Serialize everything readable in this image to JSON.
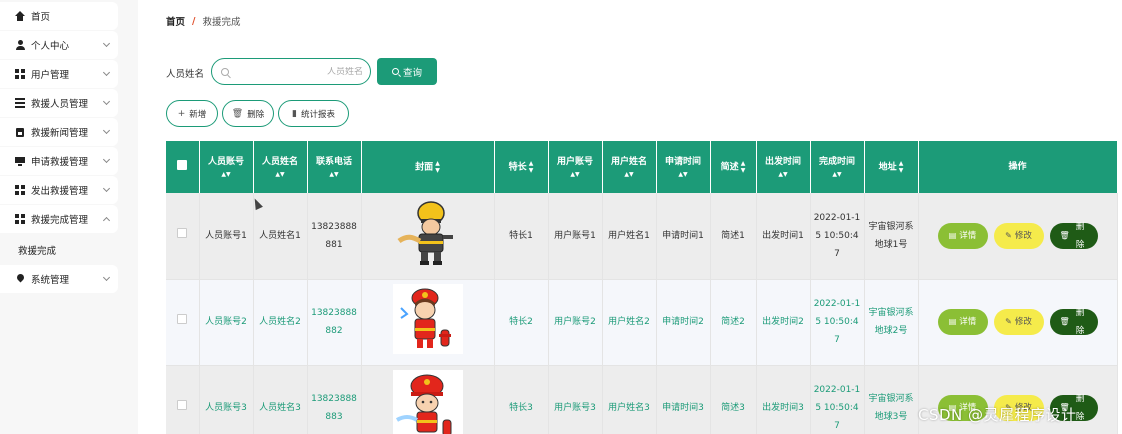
{
  "sidebar": {
    "items": [
      {
        "label": "首页",
        "icon": "home-icon"
      },
      {
        "label": "个人中心",
        "icon": "user-icon"
      },
      {
        "label": "用户管理",
        "icon": "grid-icon"
      },
      {
        "label": "救援人员管理",
        "icon": "list-icon"
      },
      {
        "label": "救援新闻管理",
        "icon": "calendar-icon"
      },
      {
        "label": "申请救援管理",
        "icon": "monitor-icon"
      },
      {
        "label": "发出救援管理",
        "icon": "grid-icon"
      },
      {
        "label": "救援完成管理",
        "icon": "grid-icon"
      },
      {
        "label": "系统管理",
        "icon": "pin-icon"
      }
    ],
    "submenu": {
      "label": "救援完成"
    }
  },
  "breadcrumb": {
    "home": "首页",
    "separator": "/",
    "current": "救援完成"
  },
  "search": {
    "label": "人员姓名",
    "placeholder": "人员姓名",
    "button": "查询"
  },
  "toolbar": {
    "add": "新增",
    "delete": "删除",
    "report": "统计报表"
  },
  "table": {
    "headers": {
      "account": "人员账号",
      "name": "人员姓名",
      "phone": "联系电话",
      "cover": "封面",
      "specialty": "特长",
      "user_account": "用户账号",
      "user_name": "用户姓名",
      "apply_time": "申请时间",
      "brief": "简述",
      "depart_time": "出发时间",
      "finish_time": "完成时间",
      "address": "地址",
      "ops": "操作"
    },
    "actions": {
      "detail": "详情",
      "edit": "修改",
      "delete": "删除"
    },
    "rows": [
      {
        "account": "人员账号1",
        "name": "人员姓名1",
        "phone": "13823888881",
        "specialty": "特长1",
        "user_account": "用户账号1",
        "user_name": "用户姓名1",
        "apply_time": "申请时间1",
        "brief": "简述1",
        "depart_time": "出发时间1",
        "finish_time": "2022-01-15 10:50:47",
        "address": "宇宙银河系地球1号"
      },
      {
        "account": "人员账号2",
        "name": "人员姓名2",
        "phone": "13823888882",
        "specialty": "特长2",
        "user_account": "用户账号2",
        "user_name": "用户姓名2",
        "apply_time": "申请时间2",
        "brief": "简述2",
        "depart_time": "出发时间2",
        "finish_time": "2022-01-15 10:50:47",
        "address": "宇宙银河系地球2号"
      },
      {
        "account": "人员账号3",
        "name": "人员姓名3",
        "phone": "13823888883",
        "specialty": "特长3",
        "user_account": "用户账号3",
        "user_name": "用户姓名3",
        "apply_time": "申请时间3",
        "brief": "简述3",
        "depart_time": "出发时间3",
        "finish_time": "2022-01-15 10:50:47",
        "address": "宇宙银河系地球3号"
      }
    ]
  },
  "colors": {
    "primary": "#1c9b78",
    "detail": "#8bbf35",
    "edit": "#f5eb4b",
    "delete": "#1f5b16"
  },
  "watermark": "CSDN @灵犀程序设计"
}
